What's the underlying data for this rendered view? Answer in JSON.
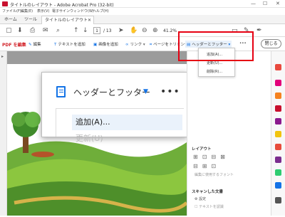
{
  "window": {
    "title": "タイトルのレイアウト - Adobe Acrobat Pro (32-bit)"
  },
  "menu": [
    "ファイル(F)",
    "編集(E)",
    "表示(V)",
    "電子サイン",
    "ウィンドウ(W)",
    "ヘルプ(H)"
  ],
  "tabs": {
    "home": "ホーム",
    "tools": "ツール",
    "document": "タイトルのレイアウト"
  },
  "toolbar": {
    "page_current": "1",
    "page_total": "/ 13",
    "zoom": "41.2%"
  },
  "editbar": {
    "mode": "PDF を編集",
    "edit": "編集",
    "add_text": "テキストを追加",
    "add_image": "画像を追加",
    "link": "リンク",
    "crop": "ページをトリミング",
    "header_footer": "ヘッダーとフッター",
    "more": "•••",
    "close": "閉じる"
  },
  "dropdown": {
    "items": [
      "追加(A)...",
      "更新(U)...",
      "削除(R)..."
    ]
  },
  "zoom": {
    "title": "ヘッダーとフッター",
    "more": "•••",
    "add": "追加(A)...",
    "update": "更新(U)"
  },
  "rightpanel": {
    "layout_title": "レイアウト",
    "layout_item": "編集に使用するフォント",
    "scan_title": "スキャンした文書",
    "scan_settings": "設定",
    "scan_recognize": "テキストを認識"
  }
}
